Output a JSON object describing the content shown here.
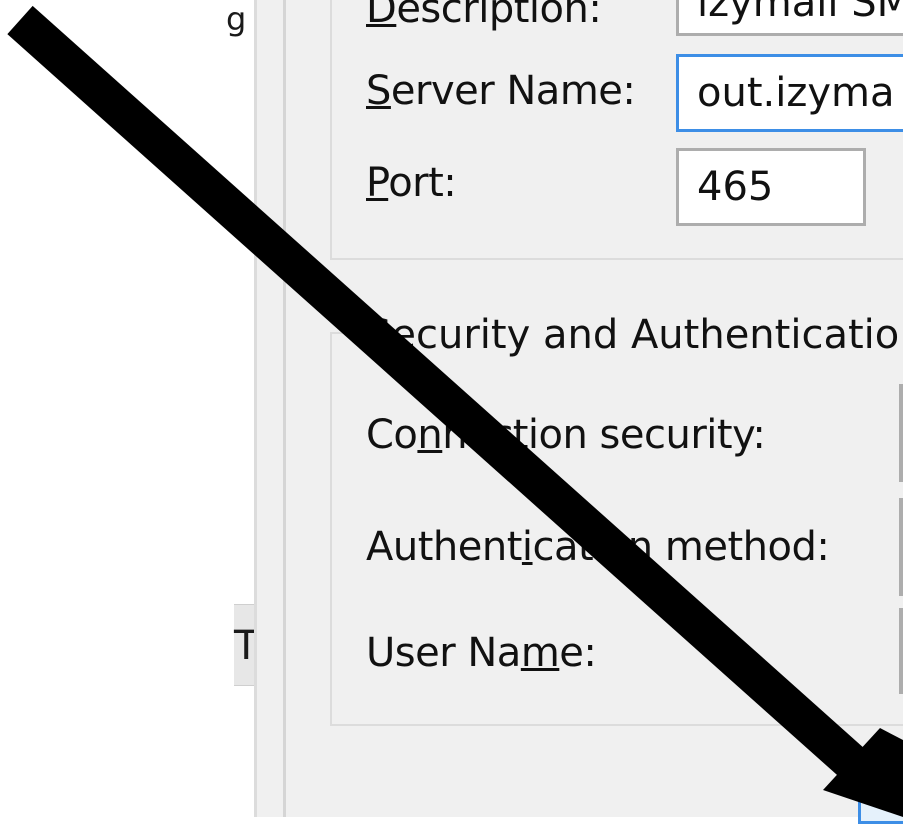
{
  "left_panel": {
    "fragment_top": "g",
    "fragment_mid": "T"
  },
  "server_settings": {
    "description_label": "Description:",
    "description_value": "izymail SM",
    "server_name_label": "Server Name:",
    "server_name_value": "out.izyma",
    "port_label": "Port:",
    "port_value": "465"
  },
  "security": {
    "legend": "Security and Authenticatio",
    "connection_security_label": "Connection security:",
    "authentication_method_label": "Authentication method:",
    "user_name_label": "User Name:"
  },
  "annotation": {
    "arrow_color": "#000000"
  }
}
